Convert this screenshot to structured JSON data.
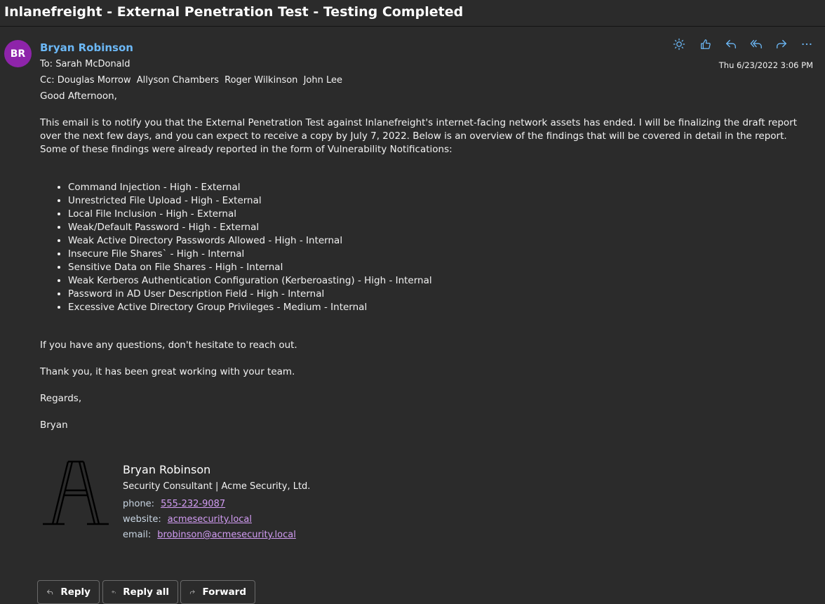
{
  "message": {
    "subject": "Inlanefreight - External Penetration Test - Testing Completed",
    "sender_initials": "BR",
    "sender_name": "Bryan Robinson",
    "to_label": "To:",
    "to": "Sarah McDonald",
    "cc_label": "Cc:",
    "cc": [
      "Douglas Morrow",
      "Allyson Chambers",
      "Roger Wilkinson",
      "John Lee"
    ],
    "date": "Thu 6/23/2022 3:06 PM",
    "avatar_color": "#8e24aa",
    "accent_color": "#6cb8f6"
  },
  "toolbar": {
    "icons": [
      "brightness-icon",
      "like-icon",
      "reply-icon",
      "reply-all-icon",
      "forward-icon",
      "more-icon"
    ]
  },
  "body": {
    "greeting": "Good Afternoon,",
    "intro": "This email is to notify you that the External Penetration Test against Inlanefreight's internet-facing network assets has ended. I will be finalizing the draft report over the next few days, and you can expect to receive a copy by July 7, 2022. Below is an overview of the findings that will be covered in detail in the report. Some of these findings were already reported in the form of Vulnerability Notifications:",
    "findings": [
      "Command Injection - High - External",
      "Unrestricted File Upload - High - External",
      "Local File Inclusion - High - External",
      "Weak/Default Password - High - External",
      "Weak Active Directory Passwords Allowed - High - Internal",
      "Insecure File Shares` - High - Internal",
      "Sensitive Data on File Shares - High - Internal",
      "Weak Kerberos Authentication Configuration (Kerberoasting) - High - Internal",
      "Password in AD User Description Field - High - Internal",
      "Excessive Active Directory Group Privileges - Medium - Internal"
    ],
    "questions": "If you have any questions, don't hesitate to reach out.",
    "thanks": "Thank you, it has been great working with your team.",
    "regards": "Regards,",
    "signoff": "Bryan"
  },
  "signature": {
    "name": "Bryan Robinson",
    "title": "Security Consultant | Acme Security, Ltd.",
    "phone_label": "phone:",
    "phone": "555-232-9087",
    "website_label": "website:",
    "website": "acmesecurity.local",
    "email_label": "email:",
    "email": "brobinson@acmesecurity.local",
    "logo_letter": "A"
  },
  "buttons": {
    "reply": "Reply",
    "reply_all": "Reply all",
    "forward": "Forward"
  }
}
